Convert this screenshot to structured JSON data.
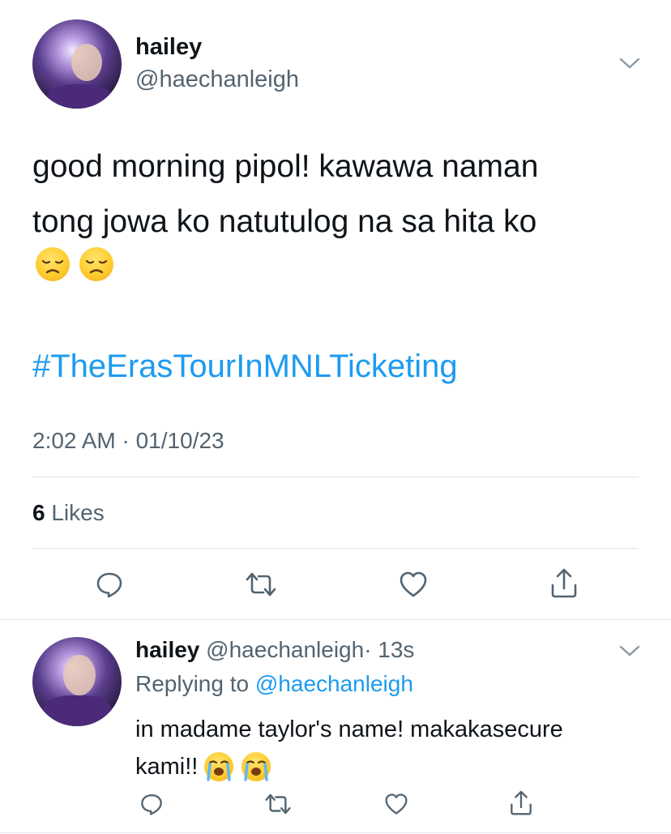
{
  "main_tweet": {
    "display_name": "hailey",
    "handle": "@haechanleigh",
    "text_line1": "good morning pipol! kawawa naman",
    "text_line2": "tong jowa ko natutulog na sa hita ko",
    "emojis": [
      "disappointed-face",
      "disappointed-face"
    ],
    "hashtag": "#TheErasTourInMNLTicketing",
    "timestamp": "2:02 AM · 01/10/23",
    "likes_count": "6",
    "likes_label": "Likes"
  },
  "reply": {
    "display_name": "hailey",
    "handle": "@haechanleigh",
    "time": "· 13s",
    "replying_to_label": "Replying to",
    "replying_to_handle": "@haechanleigh",
    "text_line1": "in madame taylor's name! makakasecure",
    "text_line2": "kami!!",
    "emojis": [
      "loudly-crying-face",
      "loudly-crying-face"
    ]
  },
  "colors": {
    "link": "#1d9bf0",
    "secondary_text": "#536471",
    "icon": "#536471",
    "divider": "#e1e4e8"
  }
}
